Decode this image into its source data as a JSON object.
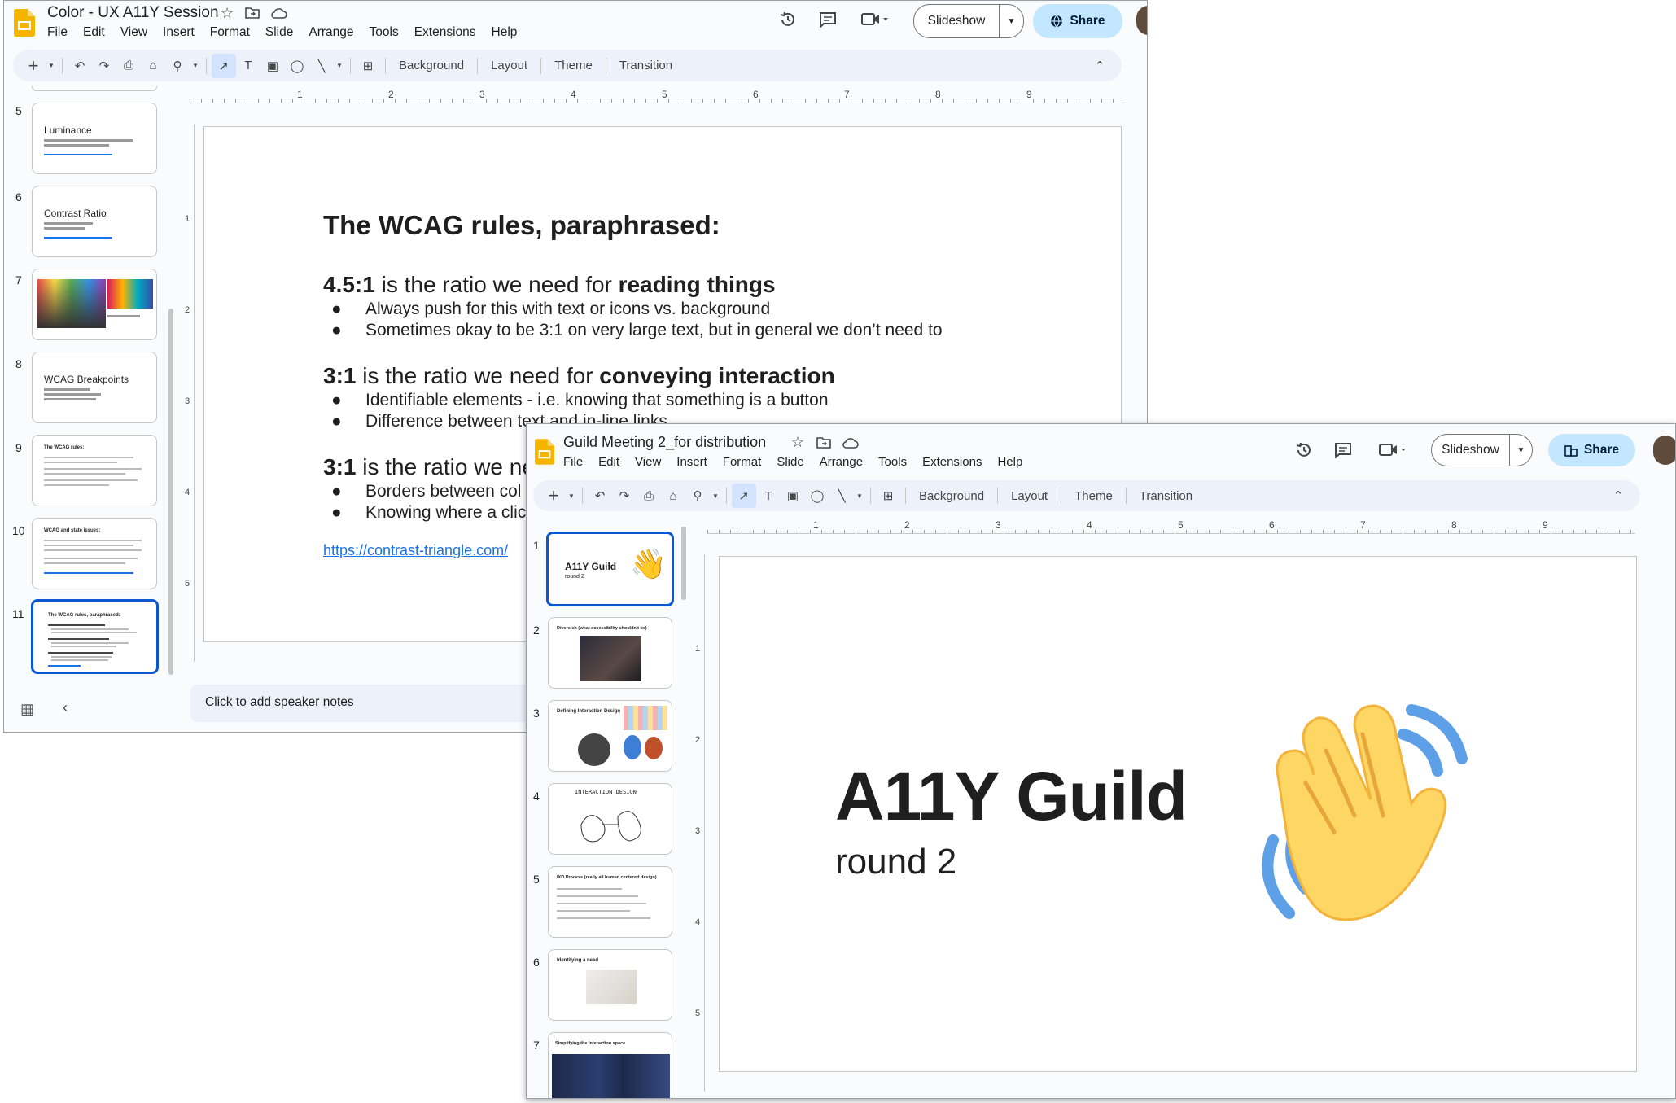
{
  "window1": {
    "doc_title": "Color - UX A11Y Session",
    "menu": [
      "File",
      "Edit",
      "View",
      "Insert",
      "Format",
      "Slide",
      "Arrange",
      "Tools",
      "Extensions",
      "Help"
    ],
    "slideshow_label": "Slideshow",
    "share_label": "Share",
    "toolbar": {
      "background": "Background",
      "layout": "Layout",
      "theme": "Theme",
      "transition": "Transition"
    },
    "ruler_h": [
      "1",
      "2",
      "3",
      "4",
      "5",
      "6",
      "7",
      "8",
      "9"
    ],
    "ruler_v": [
      "1",
      "2",
      "3",
      "4",
      "5"
    ],
    "thumbnails": [
      {
        "num": "5",
        "title": "Luminance"
      },
      {
        "num": "6",
        "title": "Contrast Ratio"
      },
      {
        "num": "7",
        "title": ""
      },
      {
        "num": "8",
        "title": "WCAG Breakpoints"
      },
      {
        "num": "9",
        "title": "The WCAG rules:"
      },
      {
        "num": "10",
        "title": "WCAG and state issues:"
      },
      {
        "num": "11",
        "title": "The WCAG rules, paraphrased:"
      }
    ],
    "slide": {
      "heading": "The WCAG rules, paraphrased:",
      "s1_ratio": "4.5:1",
      "s1_mid": " is the ratio we need for ",
      "s1_bold": "reading things",
      "s1_b1": "Always push for this with text or icons vs. background",
      "s1_b2": "Sometimes okay to be 3:1 on very large text, but in general we don’t need to",
      "s2_ratio": "3:1",
      "s2_mid": " is the ratio we need for ",
      "s2_bold": "conveying interaction",
      "s2_b1": "Identifiable elements - i.e. knowing that something is a button",
      "s2_b2": "Difference between text and in-line links",
      "s3_ratio": "3:1",
      "s3_mid": " is the ratio we ne",
      "s3_b1": "Borders between col",
      "s3_b2": "Knowing where a clic",
      "link": "https://contrast-triangle.com/"
    },
    "speaker_notes": "Click to add speaker notes"
  },
  "window2": {
    "doc_title": "Guild Meeting 2_for distribution",
    "menu": [
      "File",
      "Edit",
      "View",
      "Insert",
      "Format",
      "Slide",
      "Arrange",
      "Tools",
      "Extensions",
      "Help"
    ],
    "slideshow_label": "Slideshow",
    "share_label": "Share",
    "toolbar": {
      "background": "Background",
      "layout": "Layout",
      "theme": "Theme",
      "transition": "Transition"
    },
    "ruler_h": [
      "1",
      "2",
      "3",
      "4",
      "5",
      "6",
      "7",
      "8",
      "9"
    ],
    "ruler_v": [
      "1",
      "2",
      "3",
      "4",
      "5"
    ],
    "thumbnails": [
      {
        "num": "1",
        "title": "A11Y Guild",
        "sub": "round 2"
      },
      {
        "num": "2",
        "title": "Diversish (what accessibility shouldn't be)"
      },
      {
        "num": "3",
        "title": "Defining Interaction Design"
      },
      {
        "num": "4",
        "title": "INTERACTION DESIGN"
      },
      {
        "num": "5",
        "title": "IXD Process (really all human centered design)"
      },
      {
        "num": "6",
        "title": "Identifying a need"
      },
      {
        "num": "7",
        "title": "Simplifying the interaction space"
      }
    ],
    "slide": {
      "title": "A11Y Guild",
      "subtitle": "round 2"
    }
  },
  "colors": {
    "accent_blue": "#0b57d0",
    "share_bg": "#c2e7ff",
    "link": "#1a73e8",
    "toolbar_bg": "#edf2fa",
    "slides_yellow": "#f4b400"
  }
}
